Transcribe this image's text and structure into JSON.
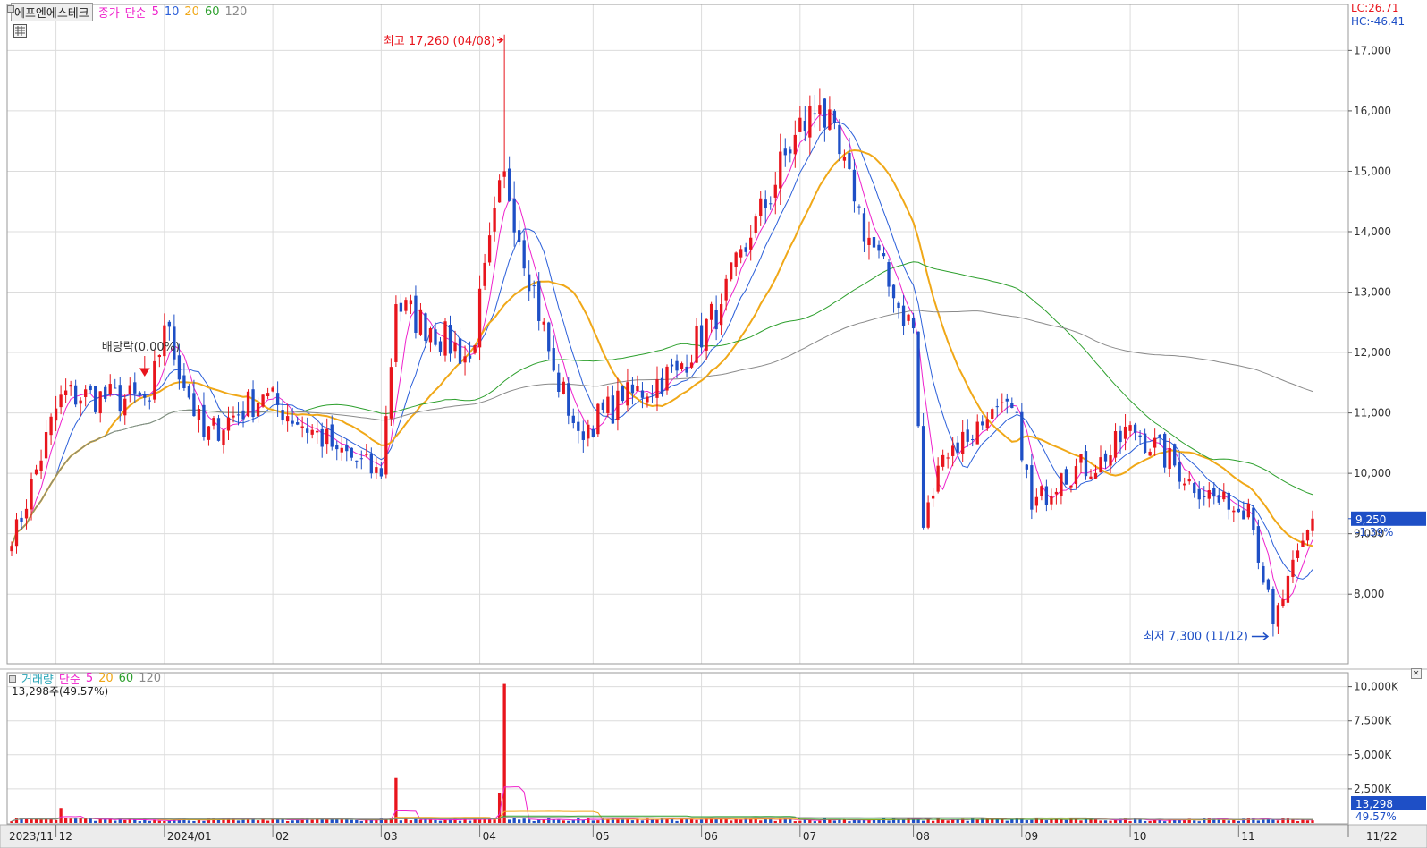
{
  "header": {
    "stock_name": "에프엔에스테크",
    "price_label": "종가",
    "ma_label": "단순",
    "ma_periods": [
      "5",
      "10",
      "20",
      "60",
      "120"
    ],
    "lc_text": "LC:26.71",
    "hc_text": "HC:-46.41"
  },
  "annotations": {
    "high": "최고 17,260 (04/08)",
    "low": "최저 7,300 (11/12)",
    "dividend": "배당락(0.00%)",
    "current_price": "9,250",
    "current_change": "-1.39%"
  },
  "volume_header": {
    "label": "거래량",
    "ma_label": "단순",
    "ma_periods": [
      "5",
      "20",
      "60",
      "120"
    ],
    "summary": "13,298주(49.57%)",
    "current_volume": "13,298",
    "current_ratio": "49.57%"
  },
  "colors": {
    "up": "#e8151d",
    "down": "#1e4fc6",
    "ma5": "#ee22cc",
    "ma10": "#2b5fd9",
    "ma20": "#f0a818",
    "ma60": "#2ea02e",
    "ma120": "#8a8a8a",
    "grid": "#dcdcdc"
  },
  "chart_data": [
    {
      "type": "candlestick",
      "title": "",
      "y_axis_ticks": [
        "8,000",
        "9,000",
        "10,000",
        "11,000",
        "12,000",
        "13,000",
        "14,000",
        "15,000",
        "16,000",
        "17,000"
      ],
      "ylim": [
        7100,
        17420
      ],
      "x_axis_ticks": [
        "2023/11",
        "12",
        "2024/01",
        "02",
        "03",
        "04",
        "05",
        "06",
        "07",
        "08",
        "09",
        "10",
        "11",
        "11/22"
      ],
      "grid": true,
      "anchors": [
        {
          "date": "2023/11/20",
          "close": 8800
        },
        {
          "date": "2023/12/04",
          "close": 11300
        },
        {
          "date": "2023/12/28",
          "close": 11200
        },
        {
          "date": "2024/01/02",
          "close": 12450
        },
        {
          "date": "2024/01/12",
          "close": 10600
        },
        {
          "date": "2024/01/30",
          "close": 11300
        },
        {
          "date": "2024/02/20",
          "close": 10400
        },
        {
          "date": "2024/03/04",
          "close": 9950
        },
        {
          "date": "2024/03/07",
          "close": 12800
        },
        {
          "date": "2024/03/18",
          "close": 12400
        },
        {
          "date": "2024/03/28",
          "close": 11900
        },
        {
          "date": "2024/04/08",
          "close": 15000,
          "high": 17260
        },
        {
          "date": "2024/04/22",
          "close": 11700
        },
        {
          "date": "2024/04/29",
          "close": 10700
        },
        {
          "date": "2024/05/10",
          "close": 11200
        },
        {
          "date": "2024/05/27",
          "close": 11700
        },
        {
          "date": "2024/06/07",
          "close": 12800
        },
        {
          "date": "2024/06/17",
          "close": 13900
        },
        {
          "date": "2024/06/28",
          "close": 15600
        },
        {
          "date": "2024/07/05",
          "close": 16100
        },
        {
          "date": "2024/07/16",
          "close": 14500
        },
        {
          "date": "2024/07/26",
          "close": 12900
        },
        {
          "date": "2024/08/01",
          "close": 12400
        },
        {
          "date": "2024/08/05",
          "close": 9100
        },
        {
          "date": "2024/08/09",
          "close": 10300
        },
        {
          "date": "2024/08/22",
          "close": 10900
        },
        {
          "date": "2024/08/30",
          "close": 11000
        },
        {
          "date": "2024/09/04",
          "close": 9400
        },
        {
          "date": "2024/09/12",
          "close": 10000
        },
        {
          "date": "2024/09/25",
          "close": 10200
        },
        {
          "date": "2024/10/02",
          "close": 10800
        },
        {
          "date": "2024/10/18",
          "close": 9900
        },
        {
          "date": "2024/10/30",
          "close": 9400
        },
        {
          "date": "2024/11/05",
          "close": 9500
        },
        {
          "date": "2024/11/12",
          "close": 7500,
          "low": 7300
        },
        {
          "date": "2024/11/22",
          "close": 9250
        }
      ],
      "series": [
        {
          "name": "5",
          "role": "ma5"
        },
        {
          "name": "10",
          "role": "ma10"
        },
        {
          "name": "20",
          "role": "ma20"
        },
        {
          "name": "60",
          "role": "ma60"
        },
        {
          "name": "120",
          "role": "ma120"
        }
      ]
    },
    {
      "type": "bar",
      "title": "",
      "y_axis_ticks": [
        "2,500K",
        "5,000K",
        "7,500K",
        "10,000K"
      ],
      "ylim": [
        0,
        10500
      ],
      "unit": "K shares",
      "volume_spikes": [
        {
          "date": "2023/12/04",
          "value": 1100
        },
        {
          "date": "2024/03/07",
          "value": 3300
        },
        {
          "date": "2024/04/08",
          "value": 10200
        },
        {
          "date": "2024/04/05",
          "value": 2200
        }
      ],
      "typical_value": 300,
      "series": [
        {
          "name": "5",
          "role": "ma5"
        },
        {
          "name": "20",
          "role": "ma20"
        },
        {
          "name": "60",
          "role": "ma60"
        },
        {
          "name": "120",
          "role": "ma120"
        }
      ]
    }
  ]
}
